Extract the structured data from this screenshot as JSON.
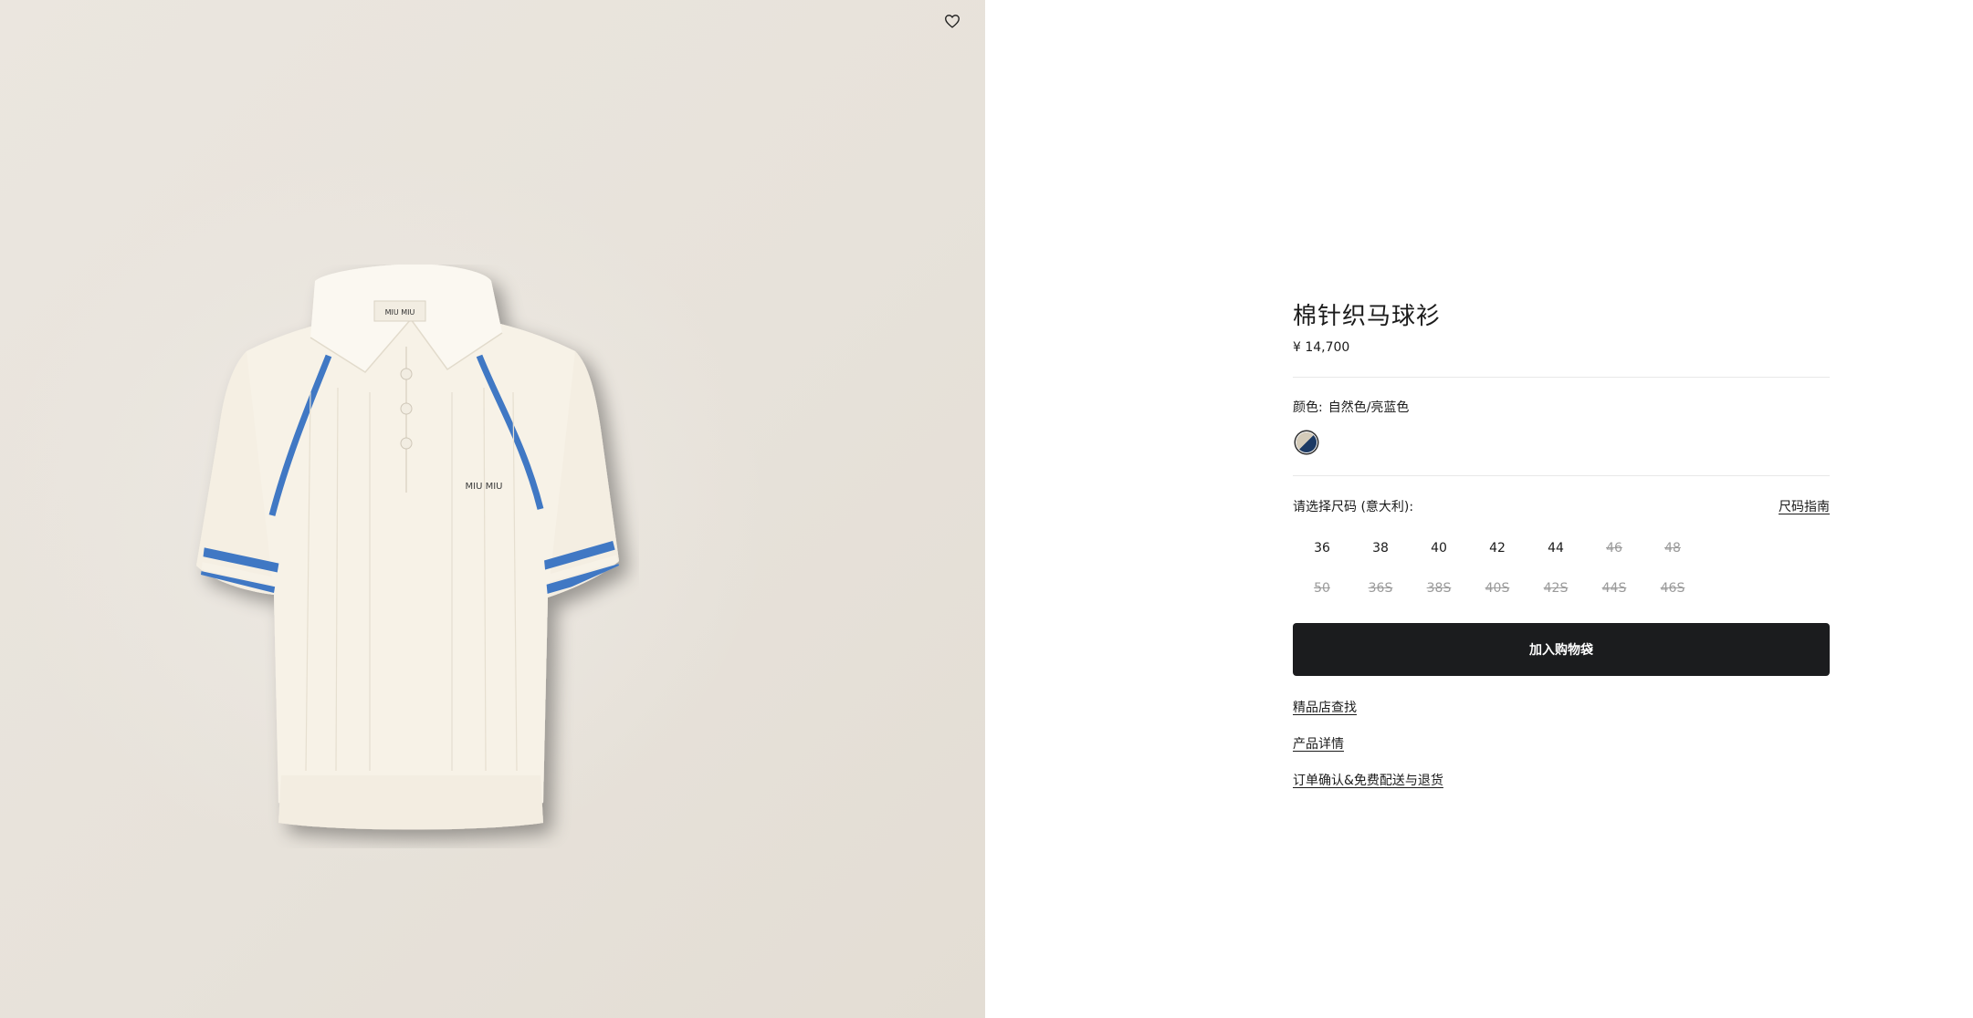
{
  "product": {
    "title": "棉针织马球衫",
    "price": "¥ 14,700",
    "logo_text": "MIU MIU"
  },
  "wishlist": {
    "icon": "heart-icon"
  },
  "color": {
    "label": "颜色:",
    "value": "自然色/亮蓝色",
    "swatch_colors": [
      "#d4cbb9",
      "#1c3a64"
    ]
  },
  "size": {
    "label": "请选择尺码 (意大利):",
    "guide_label": "尺码指南",
    "options": [
      {
        "label": "36",
        "available": true
      },
      {
        "label": "38",
        "available": true
      },
      {
        "label": "40",
        "available": true
      },
      {
        "label": "42",
        "available": true
      },
      {
        "label": "44",
        "available": true
      },
      {
        "label": "46",
        "available": false
      },
      {
        "label": "48",
        "available": false
      },
      {
        "label": "50",
        "available": false
      },
      {
        "label": "36S",
        "available": false
      },
      {
        "label": "38S",
        "available": false
      },
      {
        "label": "40S",
        "available": false
      },
      {
        "label": "42S",
        "available": false
      },
      {
        "label": "44S",
        "available": false
      },
      {
        "label": "46S",
        "available": false
      }
    ]
  },
  "add_to_bag_label": "加入购物袋",
  "links": [
    "精品店查找",
    "产品详情",
    "订单确认&免费配送与退货"
  ],
  "colors": {
    "button_bg": "#1b1c1e",
    "image_bg": "#e8e3dc",
    "stripe_blue": "#3f78c4",
    "garment": "#f6f1e6"
  }
}
